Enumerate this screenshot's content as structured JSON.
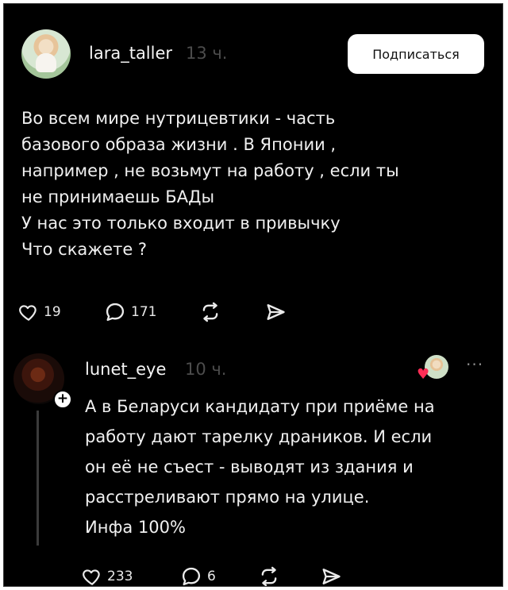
{
  "post": {
    "username": "lara_taller",
    "time": "13 ч.",
    "subscribe_label": "Подписаться",
    "text": "Во всем мире нутрицевтики - часть\nбазового образа жизни . В Японии ,\nнапример , не возьмут на работу , если ты\nне принимаешь БАДы\nУ нас это только входит в привычку\nЧто скажете ?",
    "likes": "19",
    "comments": "171"
  },
  "reply": {
    "username": "lunet_eye",
    "time": "10 ч.",
    "text": "А в Беларуси кандидату при приёме на\nработу дают тарелку драников. И если\nон её не съест - выводят из здания и\nрасстреливают прямо на улице.\nИнфа 100%",
    "likes": "233",
    "comments": "6",
    "more_label": "···"
  },
  "icons": {
    "like": "heart-outline-icon",
    "comment": "speech-bubble-icon",
    "repost": "repost-icon",
    "share": "send-icon",
    "liked_by_author": "heart-filled-icon"
  },
  "colors": {
    "background": "#000000",
    "text": "#f0f0f0",
    "muted": "#4c4c4c",
    "heart": "#ff2d55",
    "button_bg": "#ffffff"
  }
}
